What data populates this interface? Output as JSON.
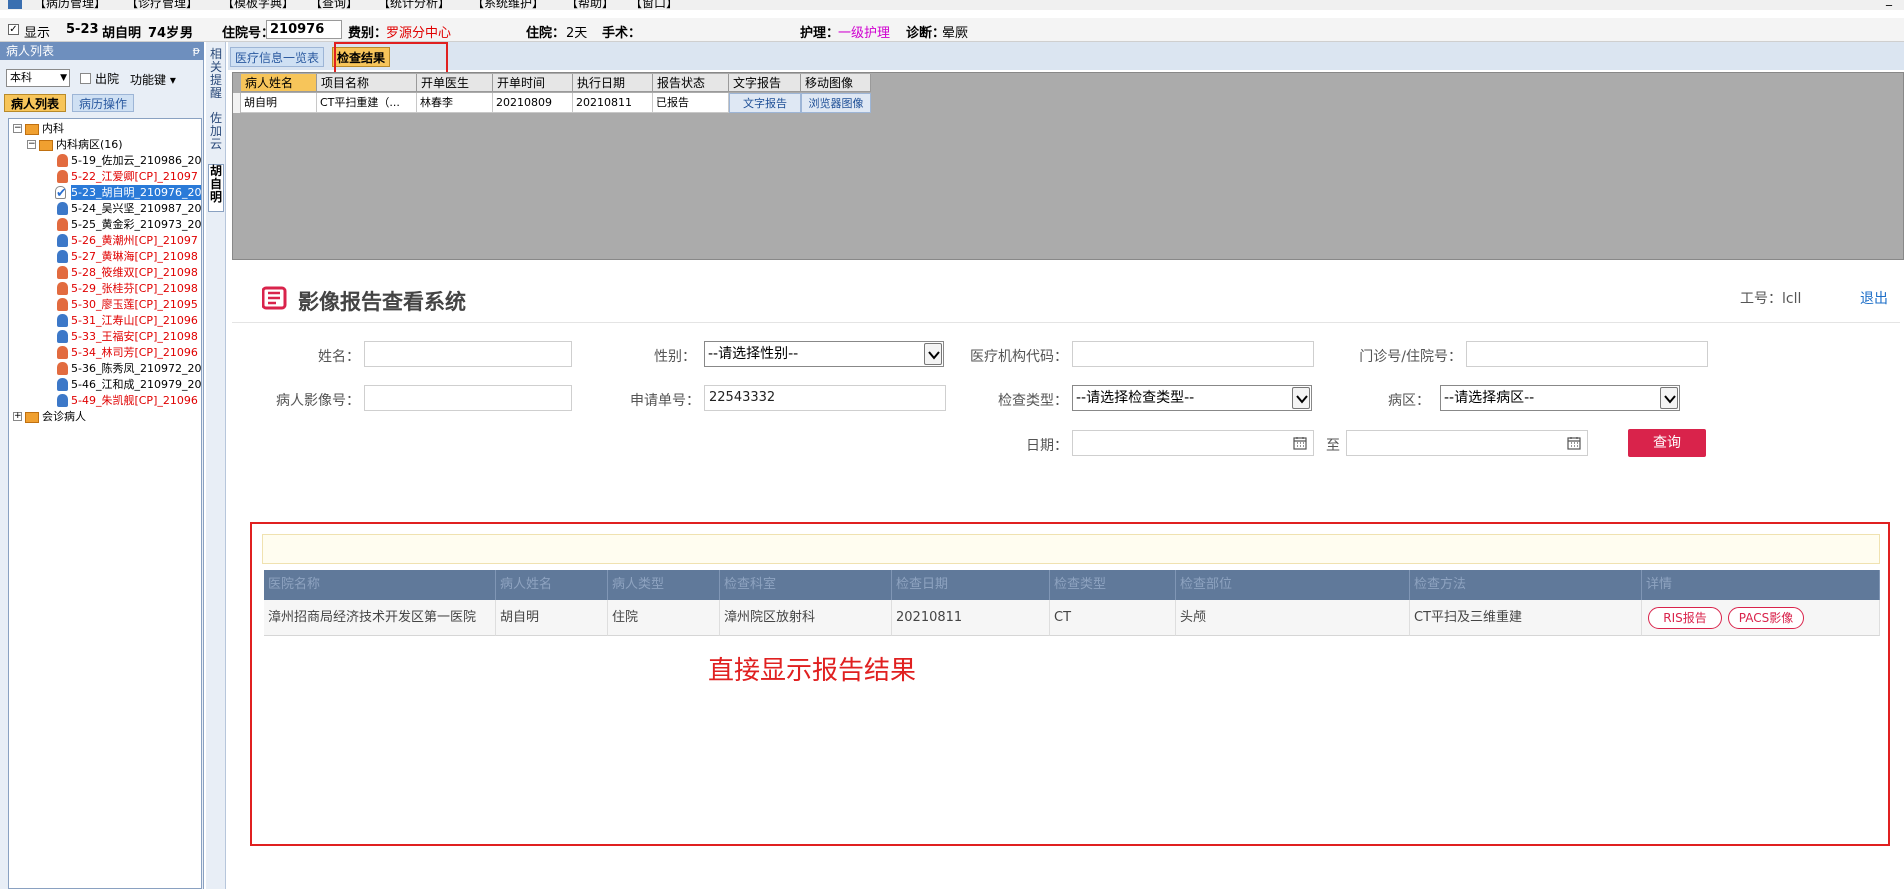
{
  "menu": {
    "items": [
      "【病历管理】",
      "【诊疗管理】",
      "【模板字典】",
      "【查询】",
      "【统计分析】",
      "【系统维护】",
      "【帮助】",
      "【窗口】"
    ],
    "minimize": "_"
  },
  "patient_bar": {
    "show_label": "显示",
    "bed": "5-23",
    "name": "胡自明",
    "age": "74岁",
    "sex": "男",
    "admission_no_label": "住院号：",
    "admission_no": "210976",
    "fee_type_label": "费别：",
    "fee_type": "罗源分中心",
    "stay_label": "住院：",
    "stay_value": "2天",
    "surgery_label": "手术：",
    "nursing_label": "护理：",
    "nursing_value": "一级护理",
    "diagnosis_label": "诊断：",
    "diagnosis_value": "晕厥"
  },
  "left_panel": {
    "title": "病人列表",
    "pin": "ᵽ",
    "dept_select": "本科",
    "discharge_label": "出院",
    "function_key": "功能键",
    "tabs": [
      "病人列表",
      "病历操作"
    ],
    "tree": {
      "root": "内科",
      "ward": "内科病区(16)",
      "patients": [
        {
          "label": "5-19_佐加云_210986_20",
          "red": false,
          "sex": "f"
        },
        {
          "label": "5-22_江爱卿[CP]_21097",
          "red": true,
          "sex": "f"
        },
        {
          "label": "5-23_胡自明_210976_20",
          "red": false,
          "sex": "chk"
        },
        {
          "label": "5-24_吴兴坚_210987_20",
          "red": false,
          "sex": "m"
        },
        {
          "label": "5-25_黄金彩_210973_20",
          "red": false,
          "sex": "f"
        },
        {
          "label": "5-26_黄潮州[CP]_21097",
          "red": true,
          "sex": "m"
        },
        {
          "label": "5-27_黄琳海[CP]_21098",
          "red": true,
          "sex": "m"
        },
        {
          "label": "5-28_筱维双[CP]_21098",
          "red": true,
          "sex": "f"
        },
        {
          "label": "5-29_张桂芬[CP]_21098",
          "red": true,
          "sex": "f"
        },
        {
          "label": "5-30_廖玉莲[CP]_21095",
          "red": true,
          "sex": "f"
        },
        {
          "label": "5-31_江寿山[CP]_21096",
          "red": true,
          "sex": "m"
        },
        {
          "label": "5-33_王福安[CP]_21098",
          "red": true,
          "sex": "m"
        },
        {
          "label": "5-34_林司芳[CP]_21096",
          "red": true,
          "sex": "f"
        },
        {
          "label": "5-36_陈秀凤_210972_20",
          "red": false,
          "sex": "f"
        },
        {
          "label": "5-46_江和成_210979_20",
          "red": false,
          "sex": "m"
        },
        {
          "label": "5-49_朱凯舰[CP]_21096",
          "red": true,
          "sex": "m"
        }
      ],
      "consult": "会诊病人"
    }
  },
  "side_tabs": [
    "相关提醒",
    "佐加云",
    "胡自明"
  ],
  "main_tabs": [
    "医疗信息一览表",
    "检查结果"
  ],
  "exam_grid": {
    "headers": [
      "病人姓名",
      "项目名称",
      "开单医生",
      "开单时间",
      "执行日期",
      "报告状态",
      "文字报告",
      "移动图像"
    ],
    "row": [
      "胡自明",
      "CT平扫重建（...",
      "林春李",
      "20210809",
      "20210811",
      "已报告",
      "文字报告",
      "浏览器图像"
    ]
  },
  "web": {
    "system_title": "影像报告查看系统",
    "staff_label": "工号：lcll",
    "logout": "退出",
    "form": {
      "name_label": "姓名：",
      "sex_label": "性别：",
      "sex_select": "--请选择性别--",
      "org_code_label": "医疗机构代码：",
      "clinic_no_label": "门诊号/住院号：",
      "image_no_label": "病人影像号：",
      "request_no_label": "申请单号：",
      "request_no_value": "22543332",
      "exam_type_label": "检查类型：",
      "exam_type_select": "--请选择检查类型--",
      "ward_label": "病区：",
      "ward_select": "--请选择病区--",
      "date_label": "日期：",
      "date_to": "至",
      "query_button": "查询"
    },
    "results": {
      "headers": [
        "医院名称",
        "病人姓名",
        "病人类型",
        "检查科室",
        "检查日期",
        "检查类型",
        "检查部位",
        "检查方法",
        "详情"
      ],
      "row": [
        "漳州招商局经济技术开发区第一医院",
        "胡自明",
        "住院",
        "漳州院区放射科",
        "20210811",
        "CT",
        "头颅",
        "CT平扫及三维重建"
      ],
      "ris_button": "RIS报告",
      "pacs_button": "PACS影像"
    },
    "annotation": "直接显示报告结果"
  },
  "colors": {
    "accent_red": "#d9234b",
    "annotation_red": "#e02020",
    "tab_active": "#f7c55a",
    "table_header": "#60799a"
  }
}
